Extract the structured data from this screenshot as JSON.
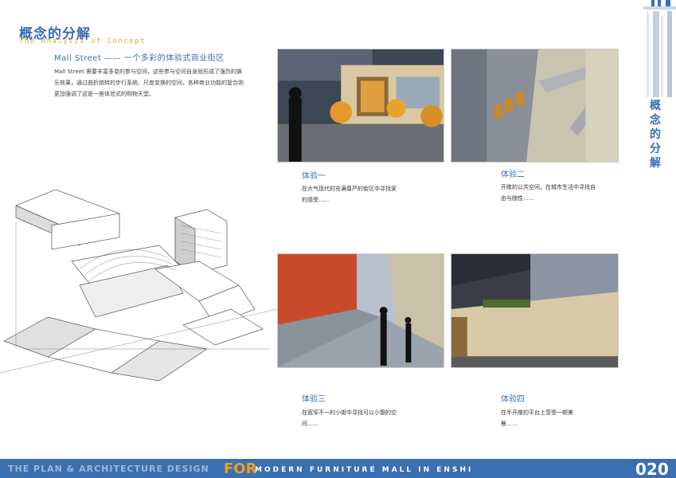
{
  "header": {
    "title_cn": "概念的分解",
    "title_en": "The Analysis of Concept",
    "subtitle": "Mall Street —— 一个多彩的体验式商业街区",
    "intro": "Mall Street 需要丰富多变的参与空间，这些参与空间自身就形成了强烈的娱乐效果，通过曲折婉转的步行系统、尺度变换的空间，各种商业功能的复合则更加强调了这是一座体验式的购物天堂。"
  },
  "side": {
    "title": "概念的分解"
  },
  "experiences": [
    {
      "title": "体验一",
      "text": "在大气现代的充满尊严的街区中寻找家的感受......"
    },
    {
      "title": "体验二",
      "text": "开敞的公共空间，在城市生活中寻找自由与随性……"
    },
    {
      "title": "体验三",
      "text": "在宽窄不一的小街中寻找可以小憩的空间……"
    },
    {
      "title": "体验四",
      "text": "在半开敞的平台上享受一顿美餐……"
    }
  ],
  "footer": {
    "left": "THE PLAN & ARCHITECTURE DESIGN",
    "for": "FOR",
    "right": "MODERN FURNITURE MALL IN ENSHI",
    "page": "020"
  },
  "colors": {
    "accent": "#3a6fb0",
    "gold": "#e0b020",
    "orange": "#f0a020"
  }
}
